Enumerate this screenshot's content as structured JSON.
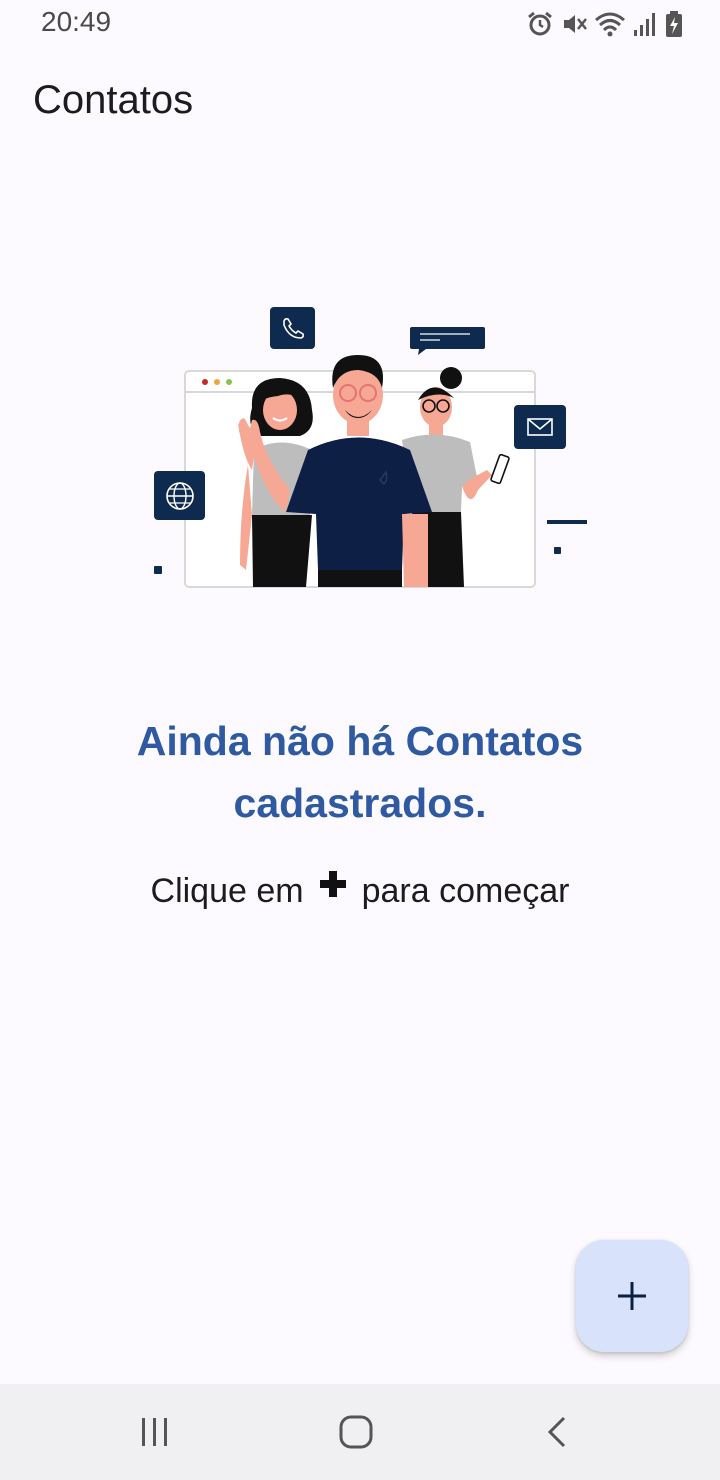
{
  "status_bar": {
    "time": "20:49",
    "icons": [
      "alarm-icon",
      "mute-icon",
      "wifi-icon",
      "signal-icon",
      "battery-charging-icon"
    ]
  },
  "app_bar": {
    "title": "Contatos"
  },
  "empty_state": {
    "illustration": "people-contacts-illustration",
    "title": "Ainda não há Contatos cadastrados.",
    "hint_before": "Clique em",
    "hint_icon": "plus-icon",
    "hint_after": "para começar"
  },
  "fab": {
    "icon": "plus-icon"
  },
  "navigation_bar": {
    "buttons": [
      "recent-apps-icon",
      "home-icon",
      "back-icon"
    ]
  },
  "colors": {
    "background": "#FCFAFE",
    "title_accent": "#2F5AA2",
    "fab_background": "#D9E2FB",
    "illustration_navy": "#0E2A4F"
  }
}
